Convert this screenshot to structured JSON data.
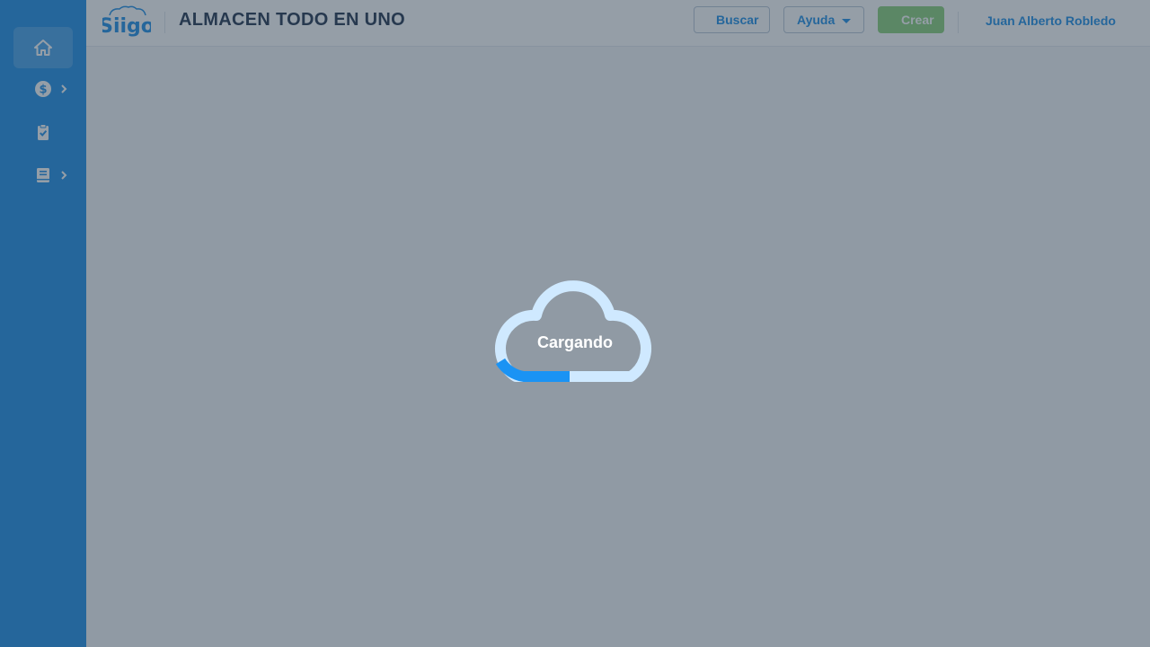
{
  "app": {
    "logo_text": "Siigo",
    "company_name": "ALMACEN TODO EN UNO"
  },
  "header": {
    "search_label": "Buscar",
    "help_label": "Ayuda",
    "create_label": "Crear",
    "user_name": "Juan Alberto Robledo"
  },
  "sidebar": {
    "items": [
      {
        "icon": "home-icon",
        "active": true
      },
      {
        "icon": "dollar-icon",
        "has_submenu": true
      },
      {
        "icon": "clipboard-check-icon"
      },
      {
        "icon": "book-icon",
        "has_submenu": true
      }
    ]
  },
  "loader": {
    "label": "Cargando",
    "progress": 0.25
  },
  "colors": {
    "sidebar": "#1f8fe6",
    "accent": "#1f8fe6",
    "create_button": "#8ad07a",
    "cloud": "#cfe9ff",
    "overlay": "rgba(44,62,80,0.5)"
  }
}
